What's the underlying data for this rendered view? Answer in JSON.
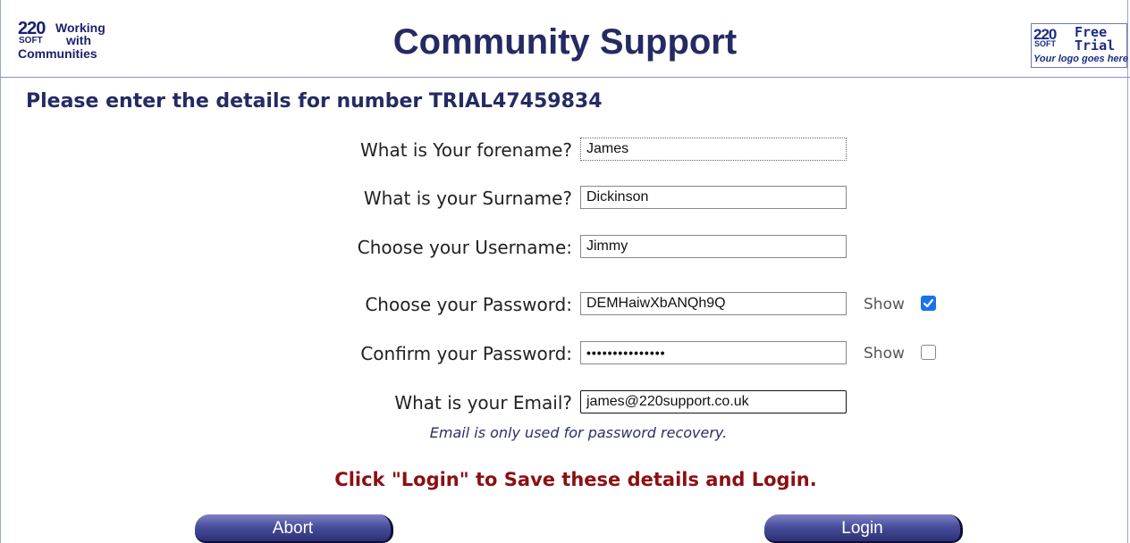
{
  "header": {
    "logo_left": {
      "number": "220",
      "soft": "SOFT",
      "line1": "Working",
      "line2": "with",
      "line3": "Communities"
    },
    "title": "Community Support",
    "logo_right": {
      "number": "220",
      "soft": "SOFT",
      "free": "Free",
      "trial": "Trial",
      "tagline": "Your logo goes here"
    }
  },
  "page_heading": "Please enter the details for number TRIAL47459834",
  "form": {
    "forename": {
      "label": "What is Your forename?",
      "value": "James"
    },
    "surname": {
      "label": "What is your Surname?",
      "value": "Dickinson"
    },
    "username": {
      "label": "Choose your Username:",
      "value": "Jimmy"
    },
    "password": {
      "label": "Choose your Password:",
      "value": "DEMHaiwXbANQh9Q",
      "show_label": "Show",
      "show_checked": true
    },
    "confirm": {
      "label": "Confirm your Password:",
      "value": "•••••••••••••••",
      "show_label": "Show",
      "show_checked": false
    },
    "email": {
      "label": "What is your Email?",
      "value": "james@220support.co.uk"
    },
    "email_hint": "Email is only used for password recovery."
  },
  "instruction": "Click \"Login\" to Save these details and Login.",
  "buttons": {
    "abort": "Abort",
    "login": "Login"
  },
  "colors": {
    "title": "#262a63",
    "instruction": "#8c0f13",
    "checkbox": "#1a73e8",
    "button": "#4a4f9c"
  }
}
